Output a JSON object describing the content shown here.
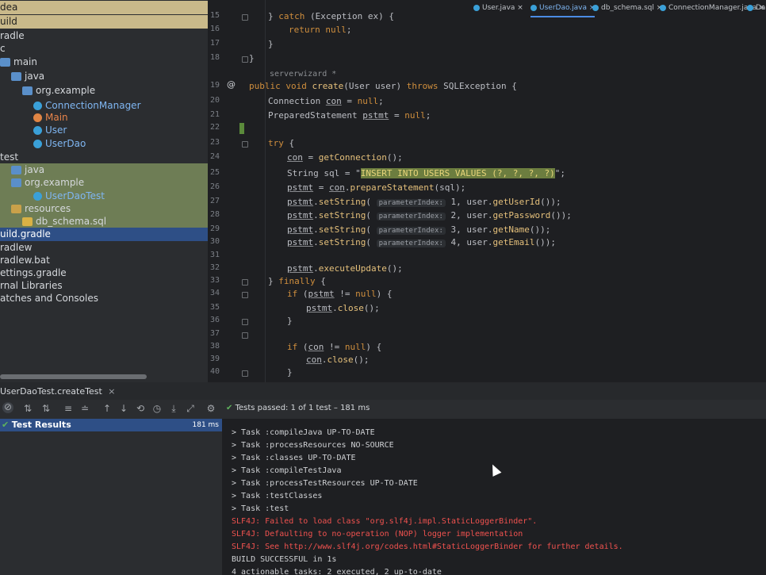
{
  "project_tree": [
    {
      "label": "dea",
      "style": "hl-yellow",
      "indent": 0,
      "icon": ""
    },
    {
      "label": "uild",
      "style": "hl-yellow",
      "indent": 0,
      "icon": ""
    },
    {
      "label": "radle",
      "style": "",
      "indent": 0,
      "icon": ""
    },
    {
      "label": "c",
      "style": "",
      "indent": 0,
      "icon": ""
    },
    {
      "label": "main",
      "style": "",
      "indent": 0,
      "icon": "folder"
    },
    {
      "label": "java",
      "style": "",
      "indent": 1,
      "icon": "folder"
    },
    {
      "label": "org.example",
      "style": "",
      "indent": 2,
      "icon": "folder"
    },
    {
      "label": "ConnectionManager",
      "style": "txt-blue",
      "indent": 3,
      "icon": "class"
    },
    {
      "label": "Main",
      "style": "txt-orange",
      "indent": 3,
      "icon": "main"
    },
    {
      "label": "User",
      "style": "txt-blue",
      "indent": 3,
      "icon": "class"
    },
    {
      "label": "UserDao",
      "style": "txt-blue",
      "indent": 3,
      "icon": "class"
    },
    {
      "label": "test",
      "style": "",
      "indent": 0,
      "icon": ""
    },
    {
      "label": "java",
      "style": "hl-green",
      "indent": 1,
      "icon": "folder"
    },
    {
      "label": "org.example",
      "style": "hl-green",
      "indent": 1,
      "icon": "folder"
    },
    {
      "label": "UserDaoTest",
      "style": "hl-green txt-blue",
      "indent": 3,
      "icon": "class"
    },
    {
      "label": "resources",
      "style": "hl-green",
      "indent": 1,
      "icon": "res"
    },
    {
      "label": "db_schema.sql",
      "style": "hl-green",
      "indent": 2,
      "icon": "sql"
    },
    {
      "label": "uild.gradle",
      "style": "hl-blue",
      "indent": 0,
      "icon": ""
    },
    {
      "label": "radlew",
      "style": "",
      "indent": 0,
      "icon": ""
    },
    {
      "label": "radlew.bat",
      "style": "",
      "indent": 0,
      "icon": ""
    },
    {
      "label": "ettings.gradle",
      "style": "",
      "indent": 0,
      "icon": ""
    },
    {
      "label": "rnal Libraries",
      "style": "",
      "indent": 0,
      "icon": ""
    },
    {
      "label": "atches and Consoles",
      "style": "",
      "indent": 0,
      "icon": ""
    }
  ],
  "tabs": [
    {
      "label": "User.java",
      "active": false
    },
    {
      "label": "UserDao.java",
      "active": true
    },
    {
      "label": "db_schema.sql",
      "active": false
    },
    {
      "label": "ConnectionManager.java",
      "active": false
    },
    {
      "label": "Da",
      "active": false
    }
  ],
  "editor": {
    "author_hint": "serverwizard *",
    "lines": [
      {
        "n": "15",
        "code": "    } catch (Exception ex) {"
      },
      {
        "n": "16",
        "code": "        return null;"
      },
      {
        "n": "17",
        "code": "    }"
      },
      {
        "n": "18",
        "code": "}"
      },
      {
        "n": "19",
        "code": "public void create(User user) throws SQLException {"
      },
      {
        "n": "20",
        "code": "    Connection con = null;"
      },
      {
        "n": "21",
        "code": "    PreparedStatement pstmt = null;"
      },
      {
        "n": "22",
        "code": ""
      },
      {
        "n": "23",
        "code": "    try {"
      },
      {
        "n": "24",
        "code": "        con = getConnection();"
      },
      {
        "n": "25",
        "code": "        String sql = \"INSERT INTO USERS VALUES (?, ?, ?, ?)\";"
      },
      {
        "n": "26",
        "code": "        pstmt = con.prepareStatement(sql);"
      },
      {
        "n": "27",
        "code": "        pstmt.setString( parameterIndex: 1, user.getUserId());"
      },
      {
        "n": "28",
        "code": "        pstmt.setString( parameterIndex: 2, user.getPassword());"
      },
      {
        "n": "29",
        "code": "        pstmt.setString( parameterIndex: 3, user.getName());"
      },
      {
        "n": "30",
        "code": "        pstmt.setString( parameterIndex: 4, user.getEmail());"
      },
      {
        "n": "31",
        "code": ""
      },
      {
        "n": "32",
        "code": "        pstmt.executeUpdate();"
      },
      {
        "n": "33",
        "code": "    } finally {"
      },
      {
        "n": "34",
        "code": "        if (pstmt != null) {"
      },
      {
        "n": "35",
        "code": "            pstmt.close();"
      },
      {
        "n": "36",
        "code": "        }"
      },
      {
        "n": "37",
        "code": ""
      },
      {
        "n": "38",
        "code": "        if (con != null) {"
      },
      {
        "n": "39",
        "code": "            con.close();"
      },
      {
        "n": "40",
        "code": "        }"
      }
    ]
  },
  "run": {
    "tab_label": "UserDaoTest.createTest",
    "status": "Tests passed: 1 of 1 test – 181 ms",
    "tree_root": "Test Results",
    "tree_time": "181 ms"
  },
  "console": [
    {
      "text": "> Task :compileJava UP-TO-DATE",
      "type": "normal"
    },
    {
      "text": "> Task :processResources NO-SOURCE",
      "type": "normal"
    },
    {
      "text": "> Task :classes UP-TO-DATE",
      "type": "normal"
    },
    {
      "text": "> Task :compileTestJava",
      "type": "normal"
    },
    {
      "text": "> Task :processTestResources UP-TO-DATE",
      "type": "normal"
    },
    {
      "text": "> Task :testClasses",
      "type": "normal"
    },
    {
      "text": "> Task :test",
      "type": "normal"
    },
    {
      "text": "SLF4J: Failed to load class \"org.slf4j.impl.StaticLoggerBinder\".",
      "type": "err"
    },
    {
      "text": "SLF4J: Defaulting to no-operation (NOP) logger implementation",
      "type": "err"
    },
    {
      "text": "SLF4J: See http://www.slf4j.org/codes.html#StaticLoggerBinder for further details.",
      "type": "err"
    },
    {
      "text": "BUILD SUCCESSFUL in 1s",
      "type": "normal"
    },
    {
      "text": "4 actionable tasks: 2 executed, 2 up-to-date",
      "type": "normal"
    }
  ]
}
